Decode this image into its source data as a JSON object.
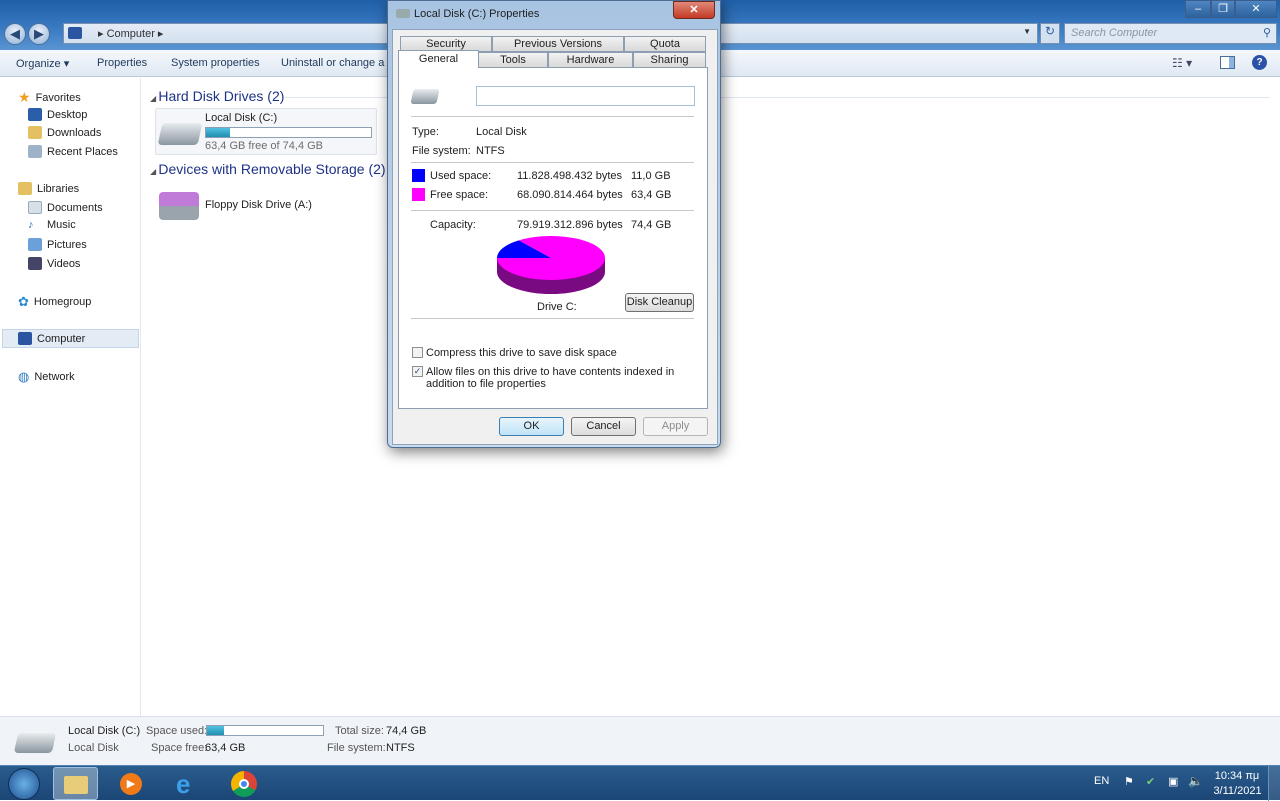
{
  "explorer": {
    "address": [
      "Computer"
    ],
    "search_placeholder": "Search Computer",
    "toolbar": [
      "Organize",
      "Properties",
      "System properties",
      "Uninstall or change a program"
    ],
    "nav": {
      "favorites": "Favorites",
      "fav_items": [
        "Desktop",
        "Downloads",
        "Recent Places"
      ],
      "libraries": "Libraries",
      "lib_items": [
        "Documents",
        "Music",
        "Pictures",
        "Videos"
      ],
      "homegroup": "Homegroup",
      "computer": "Computer",
      "network": "Network"
    },
    "groups": [
      {
        "title": "Hard Disk Drives (2)"
      },
      {
        "title": "Devices with Removable Storage (2)"
      }
    ],
    "drives": [
      {
        "name": "Local Disk (C:)",
        "free_text": "63,4 GB free of 74,4 GB",
        "used_fraction": 0.148
      },
      {
        "name": "Floppy Disk Drive (A:)"
      }
    ],
    "details": {
      "name": "Local Disk (C:)",
      "type": "Local Disk",
      "space_used_label": "Space used:",
      "space_free_label": "Space free:",
      "space_free": "63,4 GB",
      "total_label": "Total size:",
      "total": "74,4 GB",
      "fs_label": "File system:",
      "fs": "NTFS",
      "used_fraction": 0.148
    }
  },
  "dialog": {
    "title": "Local Disk (C:) Properties",
    "tabs_row1": [
      "Security",
      "Previous Versions",
      "Quota"
    ],
    "tabs_row2": [
      "General",
      "Tools",
      "Hardware",
      "Sharing"
    ],
    "active_tab": "General",
    "label_value": "",
    "type_label": "Type:",
    "type": "Local Disk",
    "fs_label": "File system:",
    "fs": "NTFS",
    "used_label": "Used space:",
    "used_bytes": "11.828.498.432 bytes",
    "used_gb": "11,0 GB",
    "free_label": "Free space:",
    "free_bytes": "68.090.814.464 bytes",
    "free_gb": "63,4 GB",
    "cap_label": "Capacity:",
    "cap_bytes": "79.919.312.896 bytes",
    "cap_gb": "74,4 GB",
    "drive_label": "Drive C:",
    "cleanup": "Disk Cleanup",
    "compress": "Compress this drive to save disk space",
    "compress_checked": false,
    "index": "Allow files on this drive to have contents indexed in addition to file properties",
    "index_checked": true,
    "ok": "OK",
    "cancel": "Cancel",
    "apply": "Apply",
    "colors": {
      "used": "#0000ff",
      "free": "#ff00ff"
    }
  },
  "taskbar": {
    "lang": "EN",
    "time": "10:34 πμ",
    "date": "3/11/2021"
  }
}
